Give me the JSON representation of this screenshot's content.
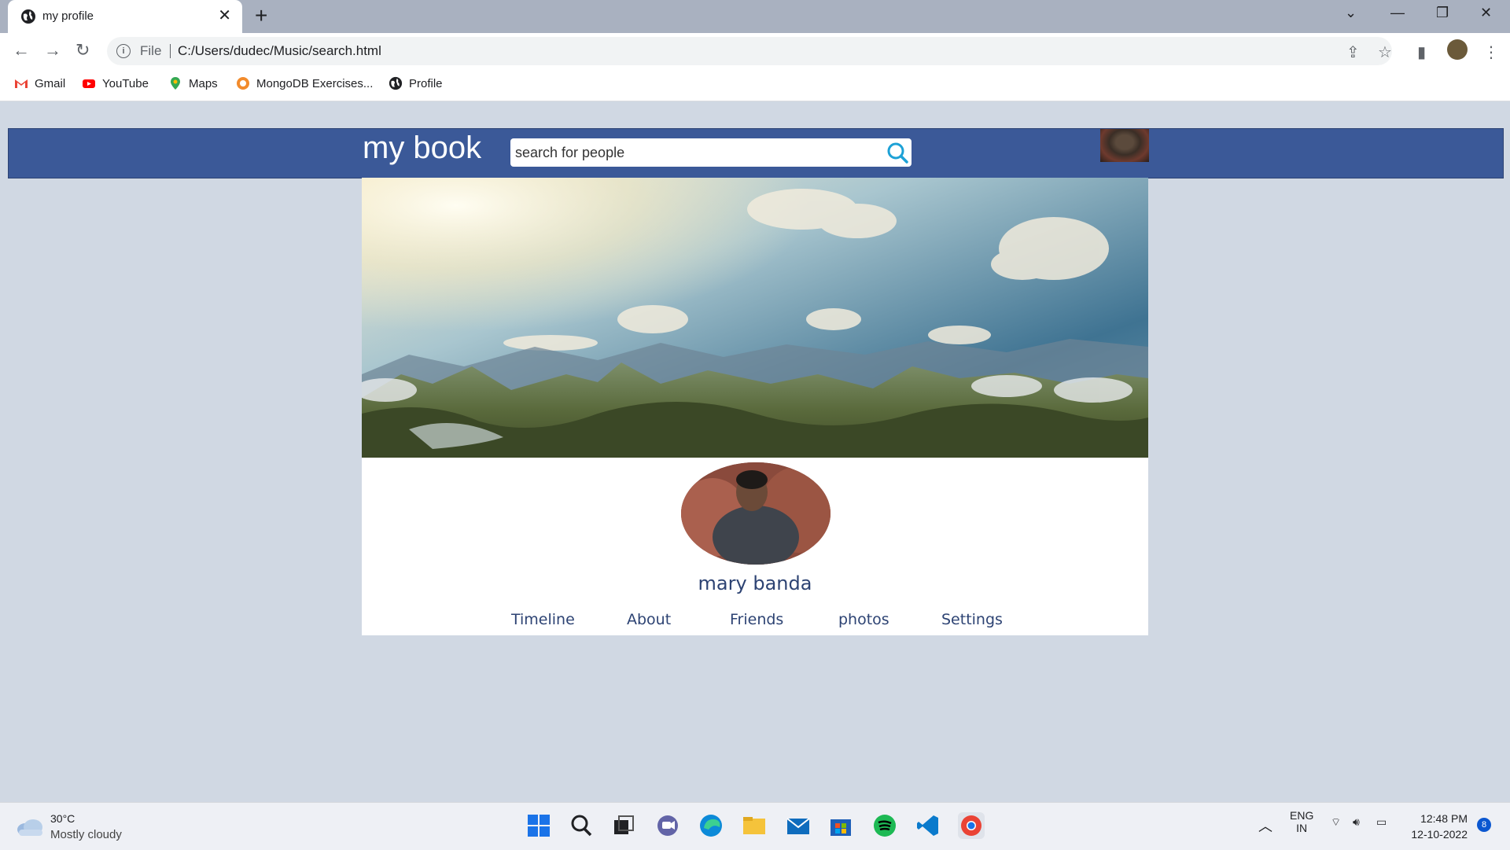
{
  "browser": {
    "tab_title": "my profile",
    "address_prefix": "File",
    "url": "C:/Users/dudec/Music/search.html",
    "bookmarks": [
      "Gmail",
      "YouTube",
      "Maps",
      "MongoDB Exercises...",
      "Profile"
    ]
  },
  "header": {
    "logo": "my book",
    "search_placeholder": "search for people"
  },
  "profile": {
    "name": "mary banda",
    "nav": [
      "Timeline",
      "About",
      "Friends",
      "photos",
      "Settings"
    ]
  },
  "taskbar": {
    "temperature": "30°C",
    "weather": "Mostly cloudy",
    "lang_1": "ENG",
    "lang_2": "IN",
    "time": "12:48 PM",
    "date": "12-10-2022",
    "notifications": "8"
  },
  "colors": {
    "header_bg": "#3b5998",
    "page_bg": "#d0d8e3",
    "link": "#2d4373"
  }
}
